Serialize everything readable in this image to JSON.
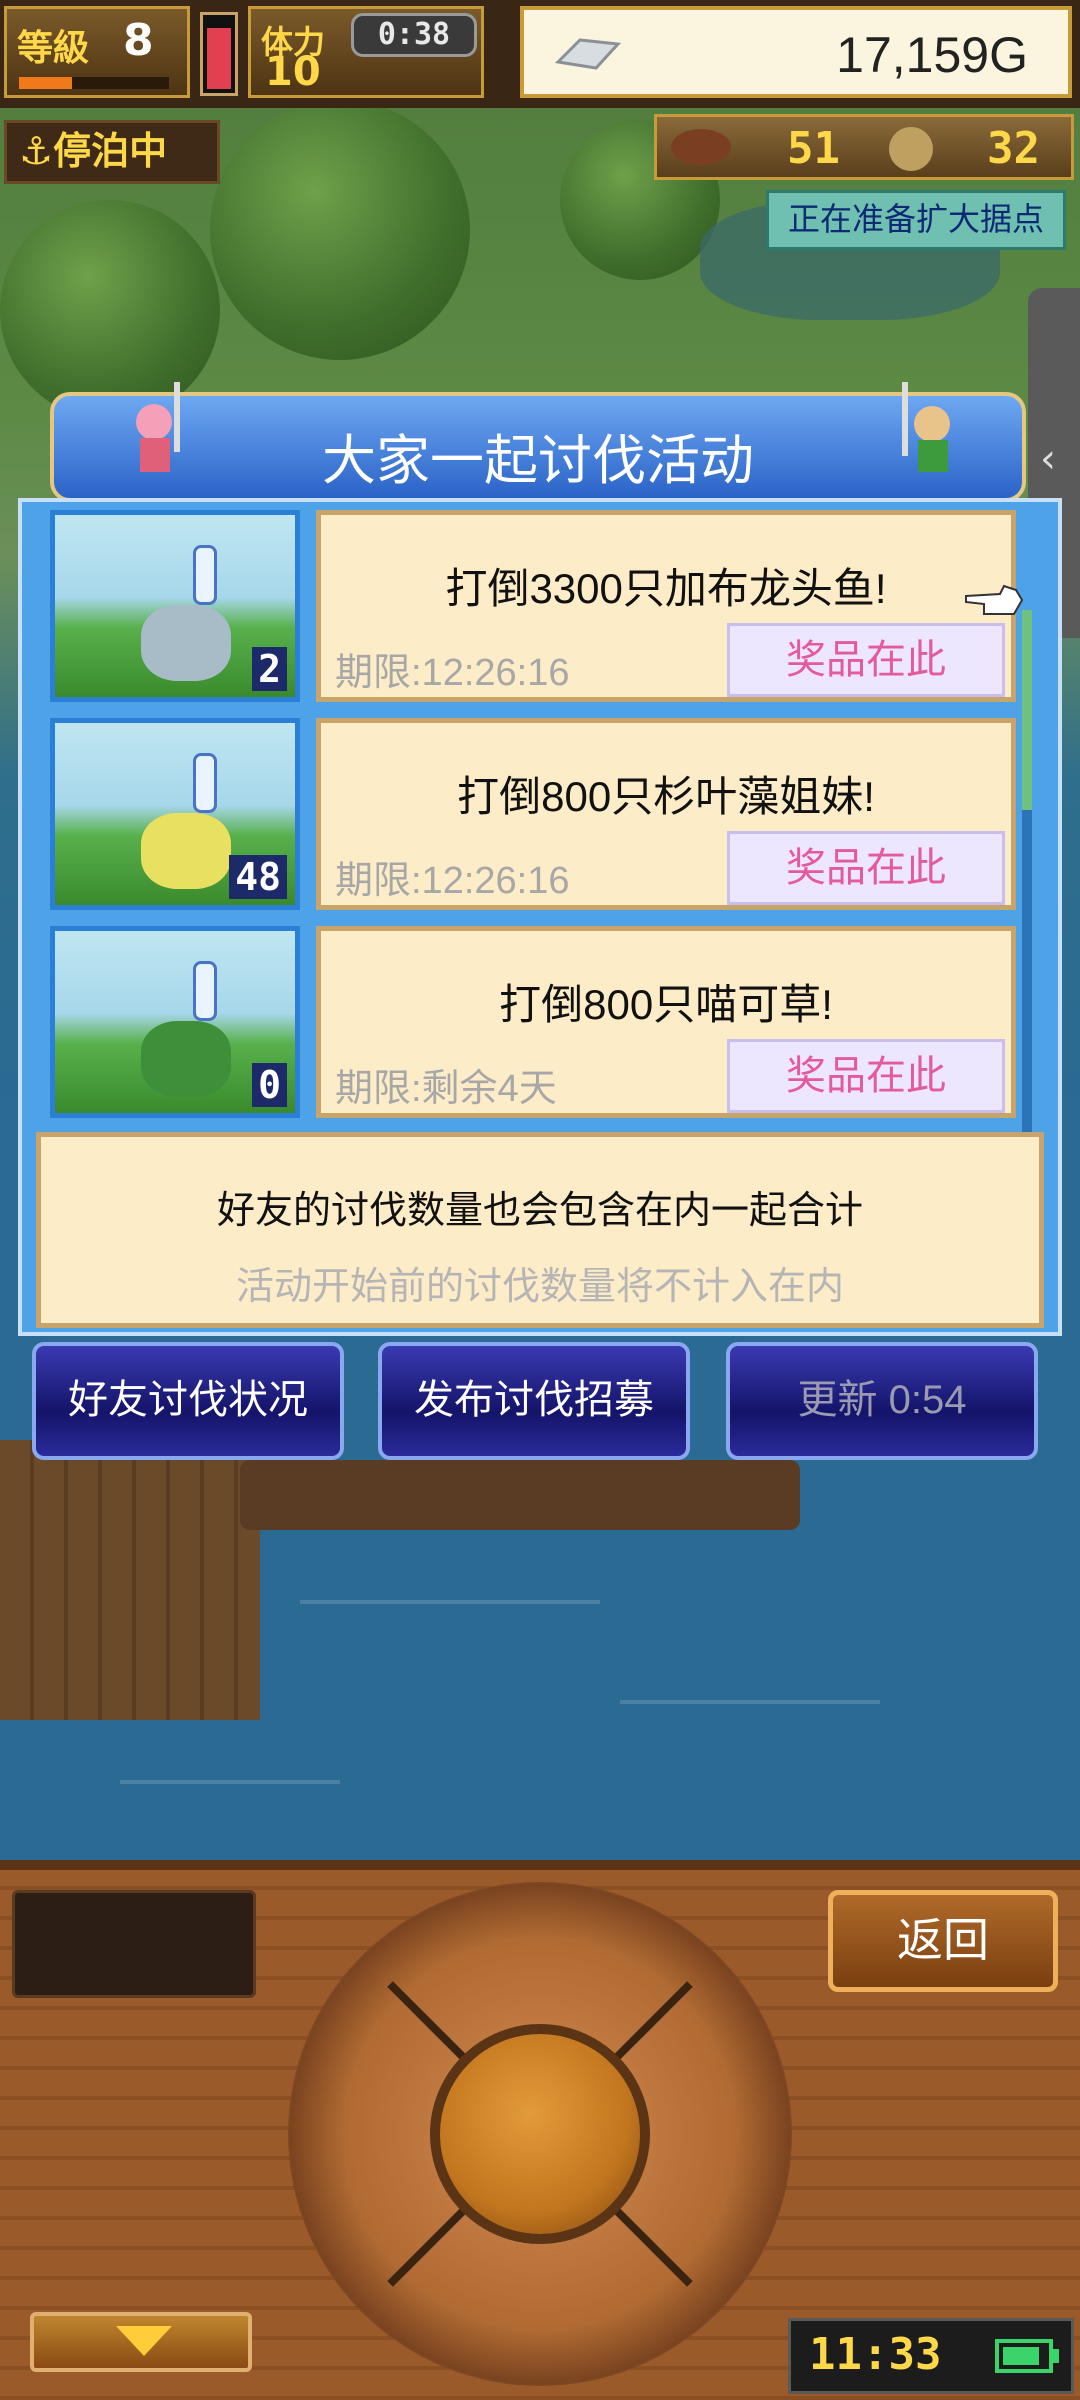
{
  "hud": {
    "level_label": "等級",
    "level": "8",
    "level_progress": 0.35,
    "stamina_label": "体力",
    "stamina": "10",
    "stamina_fill": 0.85,
    "timer": "0:38",
    "gold": "17,159G",
    "docked_label": "⚓停泊中",
    "resource_1": "51",
    "resource_2": "32",
    "expand_note": "正在准备扩大据点"
  },
  "event": {
    "title": "大家一起讨伐活动",
    "missions": [
      {
        "title": "打倒3300只加布龙头鱼!",
        "deadline": "期限:12:26:16",
        "reward_label": "奖品在此",
        "count": "2",
        "monster_color": "#a8bcc8"
      },
      {
        "title": "打倒800只杉叶藻姐妹!",
        "deadline": "期限:12:26:16",
        "reward_label": "奖品在此",
        "count": "48",
        "monster_color": "#e8e060"
      },
      {
        "title": "打倒800只喵可草!",
        "deadline": "期限:剩余4天",
        "reward_label": "奖品在此",
        "count": "0",
        "monster_color": "#3f8f3a"
      }
    ],
    "info_line_1": "好友的讨伐数量也会包含在内一起合计",
    "info_line_2": "活动开始前的讨伐数量将不计入在内"
  },
  "actions": {
    "friend_status": "好友讨伐状况",
    "post_recruit": "发布讨伐招募",
    "refresh": "更新 0:54"
  },
  "controls": {
    "back": "返回",
    "clock": "11:33"
  },
  "colors": {
    "panel_blue": "#4da2e8",
    "title_blue": "#2a63c7",
    "reward_text": "#e45aa0",
    "card_bg": "#fdecc8"
  }
}
